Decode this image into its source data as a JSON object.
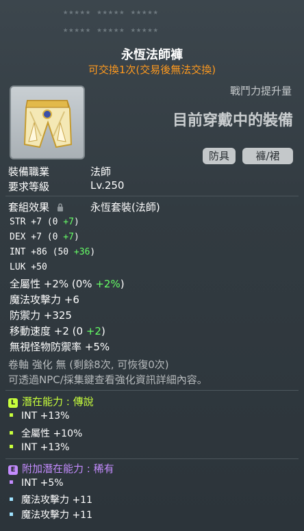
{
  "item": {
    "name": "永恆法師褲",
    "trade_note": "可交換1次(交易後無法交換)",
    "power_label": "戰鬥力提升量",
    "wearing_label": "目前穿戴中的裝備",
    "tags": [
      "防具",
      "褲/裙"
    ]
  },
  "info": {
    "job_label": "裝備職業",
    "job_value": "法師",
    "level_label": "要求等級",
    "level_value": "Lv.250",
    "set_label": "套組效果",
    "set_value": "永恆套裝(法師)"
  },
  "stats": [
    {
      "pre": "STR  +7 (0 ",
      "green": "+7",
      "post": ")"
    },
    {
      "pre": "DEX  +7 (0 ",
      "green": "+7",
      "post": ")"
    },
    {
      "pre": "INT  +86 (50 ",
      "green": "+36",
      "post": ")"
    },
    {
      "pre": "LUK  +50",
      "green": "",
      "post": ""
    },
    {
      "pre": "全屬性  +2% (0% ",
      "green": "+2%",
      "post": ")"
    },
    {
      "pre": "魔法攻擊力  +6",
      "green": "",
      "post": ""
    },
    {
      "pre": "防禦力  +325",
      "green": "",
      "post": ""
    },
    {
      "pre": "移動速度  +2 (0 ",
      "green": "+2",
      "post": ")"
    },
    {
      "pre": "無視怪物防禦率  +5%",
      "green": "",
      "post": ""
    }
  ],
  "scroll": {
    "line1": "卷軸 強化 無 (剩餘8次, 可恢復0次)",
    "line2": "可透過NPC/採集鍵查看強化資訊詳細內容。"
  },
  "potential": {
    "badge": "L",
    "title": "潛在能力 : 傳說",
    "color": "#c8ff3c",
    "lines": [
      "INT +13%",
      "全屬性 +10%",
      "INT +13%"
    ]
  },
  "bonus_potential": {
    "badge": "E",
    "title": "附加潛在能力 : 稀有",
    "color": "#c48cff",
    "lines": [
      "INT +5%",
      "魔法攻擊力 +11",
      "魔法攻擊力 +11"
    ]
  },
  "ui": {
    "stars_row1": "★★★★★ ★★★★★ ★★★★★",
    "stars_row2": "★★★★★ ★★★★★ ★★★★★"
  }
}
